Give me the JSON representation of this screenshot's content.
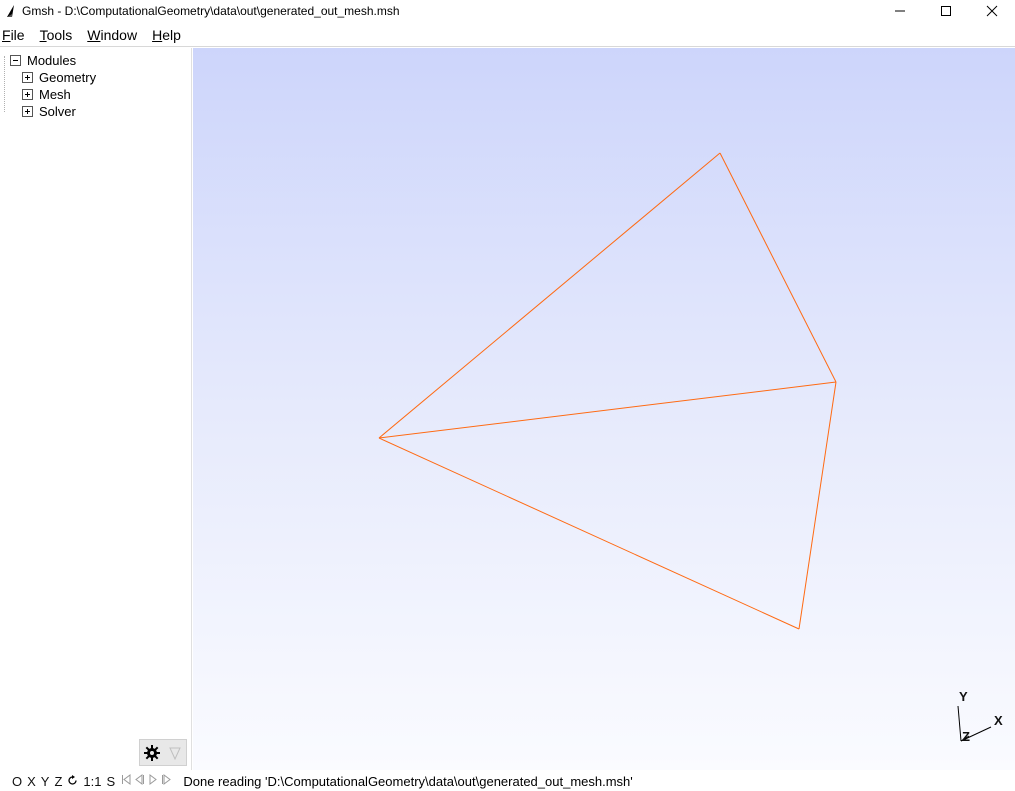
{
  "window": {
    "title": "Gmsh - D:\\ComputationalGeometry\\data\\out\\generated_out_mesh.msh",
    "app_icon": "gmsh-logo-icon",
    "controls": [
      "minimize-icon",
      "maximize-icon",
      "close-icon"
    ]
  },
  "menu": {
    "items": [
      {
        "label_first": "F",
        "label_rest": "ile"
      },
      {
        "label_first": "T",
        "label_rest": "ools"
      },
      {
        "label_first": "W",
        "label_rest": "indow"
      },
      {
        "label_first": "H",
        "label_rest": "elp"
      }
    ]
  },
  "tree": {
    "root": "Modules",
    "children": [
      "Geometry",
      "Mesh",
      "Solver"
    ]
  },
  "viewport": {
    "mesh_color": "#ff6a13",
    "axes": {
      "x": "X",
      "y": "Y",
      "z": "Z"
    },
    "background_top": "#cdd5fb",
    "background_bottom": "#fafbff"
  },
  "statusbar": {
    "buttons": [
      "O",
      "X",
      "Y",
      "Z",
      "1:1",
      "S"
    ],
    "rotate_icon": "rotate-icon",
    "message": "Done reading 'D:\\ComputationalGeometry\\data\\out\\generated_out_mesh.msh'"
  }
}
